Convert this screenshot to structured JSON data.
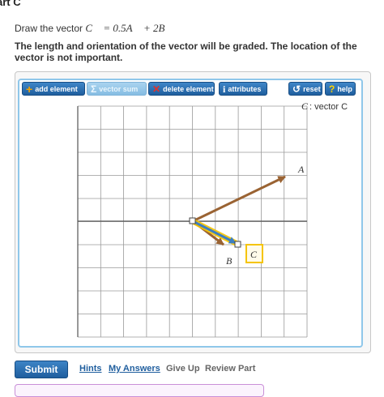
{
  "part": {
    "title": "art C"
  },
  "prompt": {
    "prefix": "Draw the vector ",
    "equation": "C⃗ = 0.5A⃗ + 2B⃗"
  },
  "instruction": "The length and orientation of the vector will be graded. The location of the vector is not important.",
  "toolbar": {
    "add_element": "add element",
    "vector_sum": "vector sum",
    "delete_element": "delete element",
    "attributes": "attributes",
    "reset": "reset",
    "help": "help"
  },
  "icons": {
    "add": "plus-icon",
    "sum": "sigma-icon",
    "delete": "cross-icon",
    "attributes": "info-icon",
    "reset": "reset-arrow-icon",
    "help": "question-icon"
  },
  "graph": {
    "legend_symbol": "C⃗",
    "legend_text": " : vector C",
    "grid_columns": 10,
    "grid_rows": 10,
    "vector_A": {
      "label": "A⃗",
      "color": "#9a6333"
    },
    "vector_B": {
      "label": "B⃗",
      "color": "#9a6333"
    },
    "vector_C": {
      "label": "C⃗",
      "color": "#3d7fc1",
      "highlight": "#f5c400"
    }
  },
  "actions": {
    "submit": "Submit",
    "hints": "Hints",
    "my_answers": "My Answers",
    "give_up": "Give Up",
    "review_part": "Review Part"
  },
  "colors": {
    "accent": "#1f5e9e",
    "toolbar_disabled": "#a9d3ef",
    "frame_border": "#8fc7ea",
    "feedback_border": "#c98fd8"
  }
}
